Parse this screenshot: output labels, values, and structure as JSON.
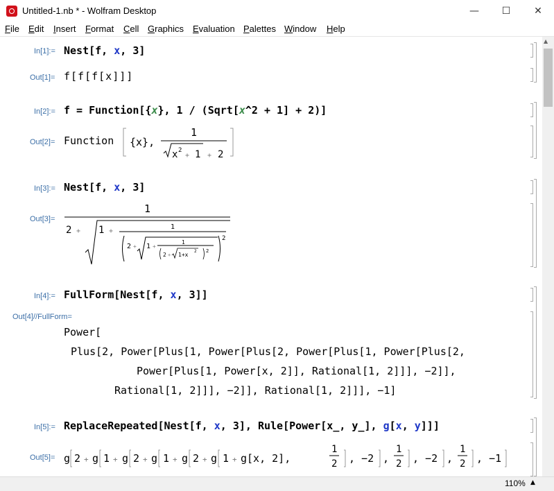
{
  "window": {
    "title": "Untitled-1.nb * - Wolfram Desktop",
    "minimize": "—",
    "maximize": "☐",
    "close": "✕"
  },
  "menu": [
    "File",
    "Edit",
    "Insert",
    "Format",
    "Cell",
    "Graphics",
    "Evaluation",
    "Palettes",
    "Window",
    "Help"
  ],
  "cells": {
    "in1_label": "In[1]:=",
    "out1_label": "Out[1]=",
    "out1_text": "f[f[f[x]]]",
    "in2_label": "In[2]:=",
    "out2_label": "Out[2]=",
    "out2_head": "Function",
    "out2_arg": "{x},",
    "in3_label": "In[3]:=",
    "out3_label": "Out[3]=",
    "in4_label": "In[4]:=",
    "out4_label": "Out[4]//FullForm=",
    "out4_line1": "Power[",
    "out4_line2": "Plus[2, Power[Plus[1, Power[Plus[2, Power[Plus[1, Power[Plus[2,",
    "out4_line3": "Power[Plus[1, Power[x, 2]], Rational[1, 2]]], −2]],",
    "out4_line4": "Rational[1, 2]]], −2]], Rational[1, 2]]], −1]",
    "in5_label": "In[5]:=",
    "out5_label": "Out[5]="
  },
  "status": {
    "zoom": "110%"
  }
}
